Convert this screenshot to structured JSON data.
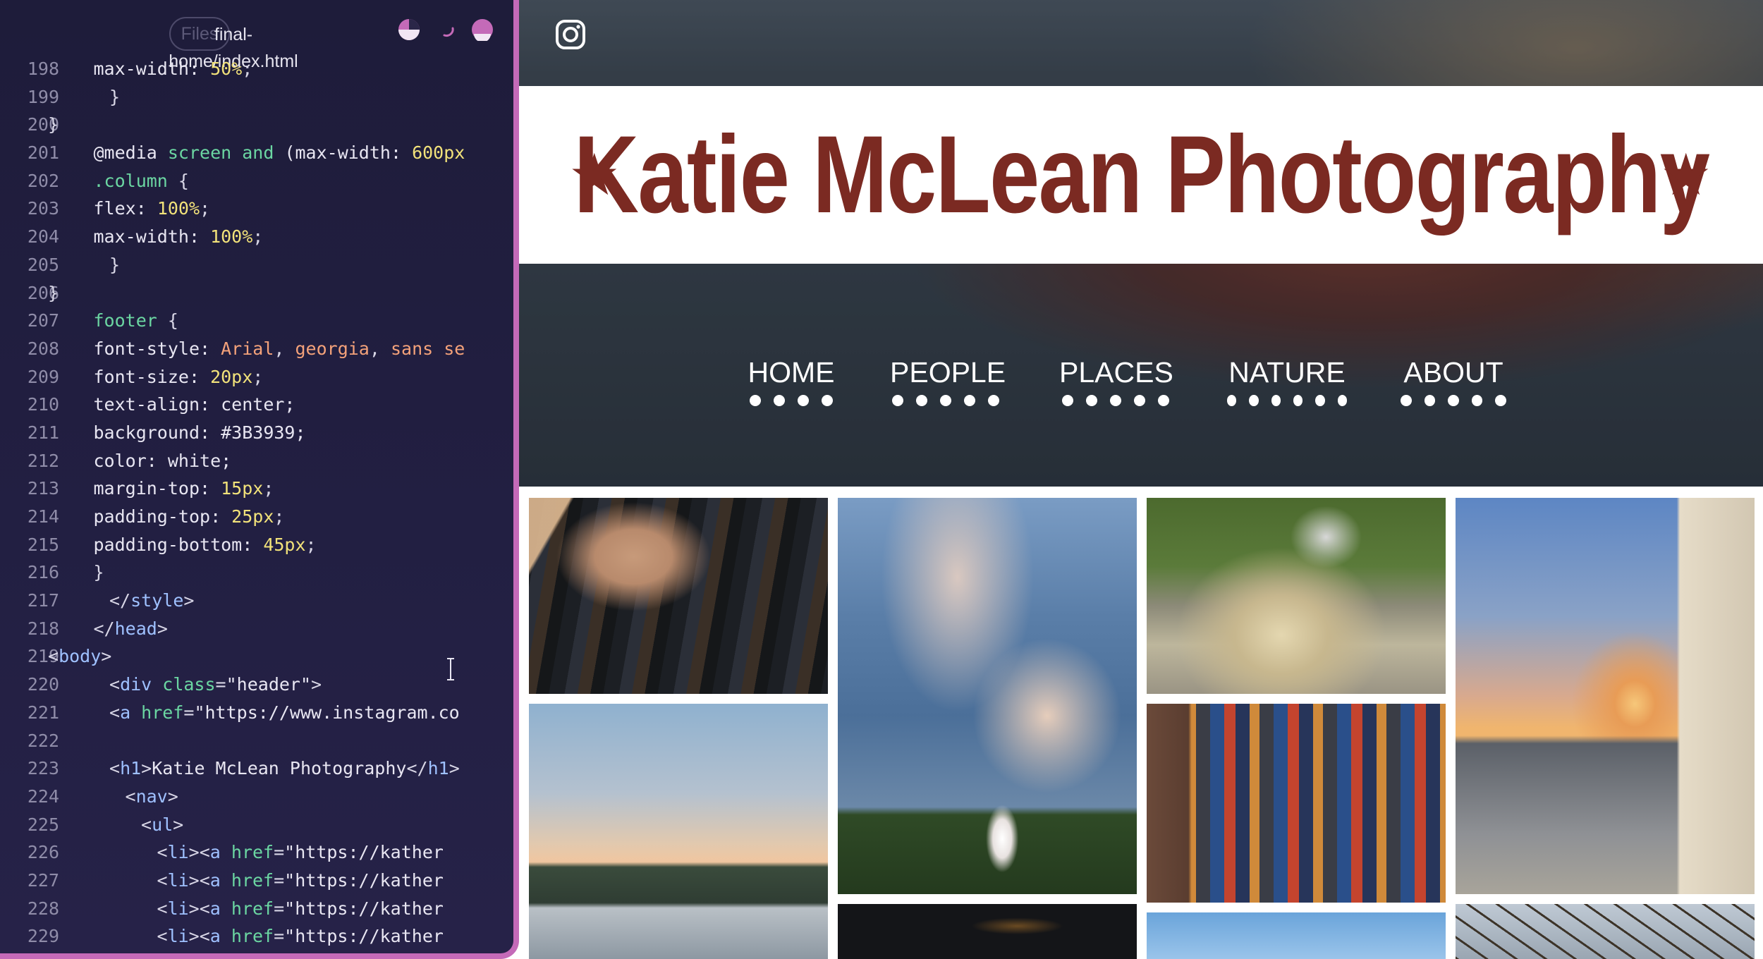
{
  "editor": {
    "files_button": "Files",
    "file_path": "final-home/index.html",
    "lines": [
      {
        "n": "198",
        "indent": 1,
        "tokens": [
          [
            "t-text",
            "max-width: "
          ],
          [
            "t-num",
            "50%"
          ],
          [
            "t-punc",
            ";"
          ]
        ]
      },
      {
        "n": "199",
        "indent": 2,
        "tokens": [
          [
            "t-punc",
            "}"
          ]
        ]
      },
      {
        "n": "200",
        "indent": 0,
        "tokens": [
          [
            "t-punc",
            "}"
          ]
        ]
      },
      {
        "n": "201",
        "indent": 1,
        "tokens": [
          [
            "t-text",
            "@media "
          ],
          [
            "t-key",
            "screen and "
          ],
          [
            "t-text",
            "(max-width: "
          ],
          [
            "t-num",
            "600px"
          ]
        ]
      },
      {
        "n": "202",
        "indent": 1,
        "tokens": [
          [
            "t-sel",
            ".column "
          ],
          [
            "t-punc",
            "{"
          ]
        ]
      },
      {
        "n": "203",
        "indent": 1,
        "tokens": [
          [
            "t-text",
            "flex: "
          ],
          [
            "t-num",
            "100%"
          ],
          [
            "t-punc",
            ";"
          ]
        ]
      },
      {
        "n": "204",
        "indent": 1,
        "tokens": [
          [
            "t-text",
            "max-width: "
          ],
          [
            "t-num",
            "100%"
          ],
          [
            "t-punc",
            ";"
          ]
        ]
      },
      {
        "n": "205",
        "indent": 2,
        "tokens": [
          [
            "t-punc",
            "}"
          ]
        ]
      },
      {
        "n": "206",
        "indent": 0,
        "tokens": [
          [
            "t-punc",
            "}"
          ]
        ]
      },
      {
        "n": "207",
        "indent": 1,
        "tokens": [
          [
            "t-sel",
            "footer "
          ],
          [
            "t-punc",
            "{"
          ]
        ]
      },
      {
        "n": "208",
        "indent": 1,
        "tokens": [
          [
            "t-text",
            "font-style: "
          ],
          [
            "t-str",
            "Arial"
          ],
          [
            "t-punc",
            ", "
          ],
          [
            "t-str",
            "georgia"
          ],
          [
            "t-punc",
            ", "
          ],
          [
            "t-str",
            "sans se"
          ]
        ]
      },
      {
        "n": "209",
        "indent": 1,
        "tokens": [
          [
            "t-text",
            "font-size: "
          ],
          [
            "t-num",
            "20px"
          ],
          [
            "t-punc",
            ";"
          ]
        ]
      },
      {
        "n": "210",
        "indent": 1,
        "tokens": [
          [
            "t-text",
            "text-align: center;"
          ]
        ]
      },
      {
        "n": "211",
        "indent": 1,
        "tokens": [
          [
            "t-text",
            "background: #3B3939;"
          ]
        ]
      },
      {
        "n": "212",
        "indent": 1,
        "tokens": [
          [
            "t-text",
            "color: white;"
          ]
        ]
      },
      {
        "n": "213",
        "indent": 1,
        "tokens": [
          [
            "t-text",
            "margin-top: "
          ],
          [
            "t-num",
            "15px"
          ],
          [
            "t-punc",
            ";"
          ]
        ]
      },
      {
        "n": "214",
        "indent": 1,
        "tokens": [
          [
            "t-text",
            "padding-top: "
          ],
          [
            "t-num",
            "25px"
          ],
          [
            "t-punc",
            ";"
          ]
        ]
      },
      {
        "n": "215",
        "indent": 1,
        "tokens": [
          [
            "t-text",
            "padding-bottom: "
          ],
          [
            "t-num",
            "45px"
          ],
          [
            "t-punc",
            ";"
          ]
        ]
      },
      {
        "n": "216",
        "indent": 1,
        "tokens": [
          [
            "t-punc",
            "}"
          ]
        ]
      },
      {
        "n": "217",
        "indent": 2,
        "tokens": [
          [
            "t-punc",
            "</"
          ],
          [
            "t-tag",
            "style"
          ],
          [
            "t-punc",
            ">"
          ]
        ]
      },
      {
        "n": "218",
        "indent": 1,
        "tokens": [
          [
            "t-punc",
            "</"
          ],
          [
            "t-tag",
            "head"
          ],
          [
            "t-punc",
            ">"
          ]
        ]
      },
      {
        "n": "219",
        "indent": 0,
        "tokens": [
          [
            "t-punc",
            "<"
          ],
          [
            "t-tag",
            "body"
          ],
          [
            "t-punc",
            ">"
          ]
        ]
      },
      {
        "n": "220",
        "indent": 2,
        "tokens": [
          [
            "t-punc",
            "<"
          ],
          [
            "t-tag",
            "div "
          ],
          [
            "t-key",
            "class"
          ],
          [
            "t-punc",
            "="
          ],
          [
            "t-text",
            "\"header\""
          ],
          [
            "t-punc",
            ">"
          ]
        ]
      },
      {
        "n": "221",
        "indent": 2,
        "tokens": [
          [
            "t-punc",
            "<"
          ],
          [
            "t-tag",
            "a "
          ],
          [
            "t-key",
            "href"
          ],
          [
            "t-punc",
            "="
          ],
          [
            "t-text",
            "\"https://www.instagram.co"
          ]
        ]
      },
      {
        "n": "222",
        "indent": 0,
        "tokens": []
      },
      {
        "n": "223",
        "indent": 2,
        "tokens": [
          [
            "t-punc",
            "<"
          ],
          [
            "t-tag",
            "h1"
          ],
          [
            "t-punc",
            ">"
          ],
          [
            "t-text",
            "Katie McLean Photography"
          ],
          [
            "t-punc",
            "</"
          ],
          [
            "t-tag",
            "h1"
          ],
          [
            "t-punc",
            ">"
          ]
        ]
      },
      {
        "n": "224",
        "indent": 3,
        "tokens": [
          [
            "t-punc",
            "<"
          ],
          [
            "t-tag",
            "nav"
          ],
          [
            "t-punc",
            ">"
          ]
        ]
      },
      {
        "n": "225",
        "indent": 4,
        "tokens": [
          [
            "t-punc",
            "<"
          ],
          [
            "t-tag",
            "ul"
          ],
          [
            "t-punc",
            ">"
          ]
        ]
      },
      {
        "n": "226",
        "indent": 5,
        "tokens": [
          [
            "t-punc",
            "<"
          ],
          [
            "t-tag",
            "li"
          ],
          [
            "t-punc",
            "><"
          ],
          [
            "t-tag",
            "a "
          ],
          [
            "t-key",
            "href"
          ],
          [
            "t-punc",
            "="
          ],
          [
            "t-text",
            "\"https://kather"
          ]
        ]
      },
      {
        "n": "227",
        "indent": 5,
        "tokens": [
          [
            "t-punc",
            "<"
          ],
          [
            "t-tag",
            "li"
          ],
          [
            "t-punc",
            "><"
          ],
          [
            "t-tag",
            "a "
          ],
          [
            "t-key",
            "href"
          ],
          [
            "t-punc",
            "="
          ],
          [
            "t-text",
            "\"https://kather"
          ]
        ]
      },
      {
        "n": "228",
        "indent": 5,
        "tokens": [
          [
            "t-punc",
            "<"
          ],
          [
            "t-tag",
            "li"
          ],
          [
            "t-punc",
            "><"
          ],
          [
            "t-tag",
            "a "
          ],
          [
            "t-key",
            "href"
          ],
          [
            "t-punc",
            "="
          ],
          [
            "t-text",
            "\"https://kather"
          ]
        ]
      },
      {
        "n": "229",
        "indent": 5,
        "tokens": [
          [
            "t-punc",
            "<"
          ],
          [
            "t-tag",
            "li"
          ],
          [
            "t-punc",
            "><"
          ],
          [
            "t-tag",
            "a "
          ],
          [
            "t-key",
            "href"
          ],
          [
            "t-punc",
            "="
          ],
          [
            "t-text",
            "\"https://kather"
          ]
        ]
      }
    ]
  },
  "site": {
    "title": "Katie McLean Photography",
    "star": "★",
    "nav": [
      {
        "label": "HOME",
        "dots": 4
      },
      {
        "label": "PEOPLE",
        "dots": 5
      },
      {
        "label": "PLACES",
        "dots": 5
      },
      {
        "label": "NATURE",
        "dots": 6
      },
      {
        "label": "ABOUT",
        "dots": 5
      }
    ],
    "colors": {
      "title": "#7b2a22",
      "editor_border": "#c46ab8",
      "editor_bg": "#221f42"
    }
  }
}
